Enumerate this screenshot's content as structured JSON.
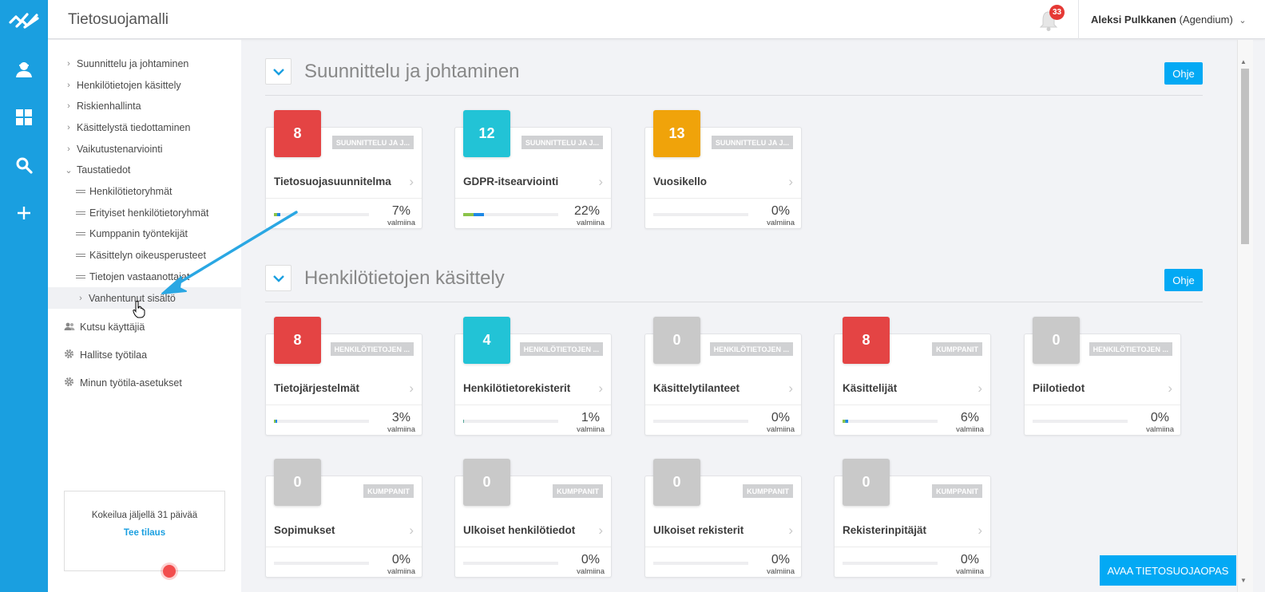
{
  "app": {
    "title": "Tietosuojamalli",
    "notif_count": "33",
    "user_name": "Aleksi Pulkkanen",
    "user_org": "(Agendium)",
    "chevron": "⌄"
  },
  "rail": {
    "icons": [
      "logo-icon",
      "user-icon",
      "dashboard-icon",
      "search-icon",
      "plus-icon"
    ]
  },
  "nav": {
    "items": [
      "Suunnittelu ja johtaminen",
      "Henkilötietojen käsittely",
      "Riskienhallinta",
      "Käsittelystä tiedottaminen",
      "Vaikutustenarviointi",
      "Taustatiedot"
    ],
    "sub": [
      "Henkilötietoryhmät",
      "Erityiset henkilötietoryhmät",
      "Kumppanin työntekijät",
      "Käsittelyn oikeusperusteet",
      "Tietojen vastaanottajat",
      "Vanhentunut sisältö"
    ],
    "actions": [
      "Kutsu käyttäjiä",
      "Hallitse työtilaa",
      "Minun työtila-asetukset"
    ]
  },
  "trial": {
    "text": "Kokeilua jäljellä 31 päivää",
    "link": "Tee tilaus"
  },
  "ohje": "Ohje",
  "valmiina": "valmiina",
  "avaa": "AVAA TIETOSUOJAOPAS",
  "colors": {
    "accent": "#1a9fe0",
    "red": "#e44444",
    "teal": "#22c3d6",
    "orange": "#f0a30a",
    "grey": "#c9c9c9",
    "progress_green": "#8bc34a",
    "progress_blue": "#1e88e5"
  },
  "sections": [
    {
      "title": "Suunnittelu ja johtaminen",
      "cards": [
        {
          "count": "8",
          "color": "red",
          "tag": "SUUNNITTELU JA J...",
          "title": "Tietosuojasuunnitelma",
          "progress": 0.07,
          "percent": "7%"
        },
        {
          "count": "12",
          "color": "teal",
          "tag": "SUUNNITTELU JA J...",
          "title": "GDPR-itsearviointi",
          "progress": 0.22,
          "percent": "22%"
        },
        {
          "count": "13",
          "color": "orange",
          "tag": "SUUNNITTELU JA J...",
          "title": "Vuosikello",
          "progress": 0,
          "percent": "0%"
        }
      ]
    },
    {
      "title": "Henkilötietojen käsittely",
      "cards": [
        {
          "count": "8",
          "color": "red",
          "tag": "HENKILÖTIETOJEN ...",
          "title": "Tietojärjestelmät",
          "progress": 0.03,
          "percent": "3%"
        },
        {
          "count": "4",
          "color": "teal",
          "tag": "HENKILÖTIETOJEN ...",
          "title": "Henkilötietorekisterit",
          "progress": 0.01,
          "percent": "1%"
        },
        {
          "count": "0",
          "color": "grey",
          "tag": "HENKILÖTIETOJEN ...",
          "title": "Käsittelytilanteet",
          "progress": 0,
          "percent": "0%"
        },
        {
          "count": "8",
          "color": "red",
          "tag": "KUMPPANIT",
          "title": "Käsittelijät",
          "progress": 0.06,
          "percent": "6%"
        },
        {
          "count": "0",
          "color": "grey",
          "tag": "HENKILÖTIETOJEN ...",
          "title": "Piilotiedot",
          "progress": 0,
          "percent": "0%"
        },
        {
          "count": "0",
          "color": "grey",
          "tag": "KUMPPANIT",
          "title": "Sopimukset",
          "progress": 0,
          "percent": "0%"
        },
        {
          "count": "0",
          "color": "grey",
          "tag": "KUMPPANIT",
          "title": "Ulkoiset henkilötiedot",
          "progress": 0,
          "percent": "0%"
        },
        {
          "count": "0",
          "color": "grey",
          "tag": "KUMPPANIT",
          "title": "Ulkoiset rekisterit",
          "progress": 0,
          "percent": "0%"
        },
        {
          "count": "0",
          "color": "grey",
          "tag": "KUMPPANIT",
          "title": "Rekisterinpitäjät",
          "progress": 0,
          "percent": "0%"
        }
      ]
    }
  ]
}
